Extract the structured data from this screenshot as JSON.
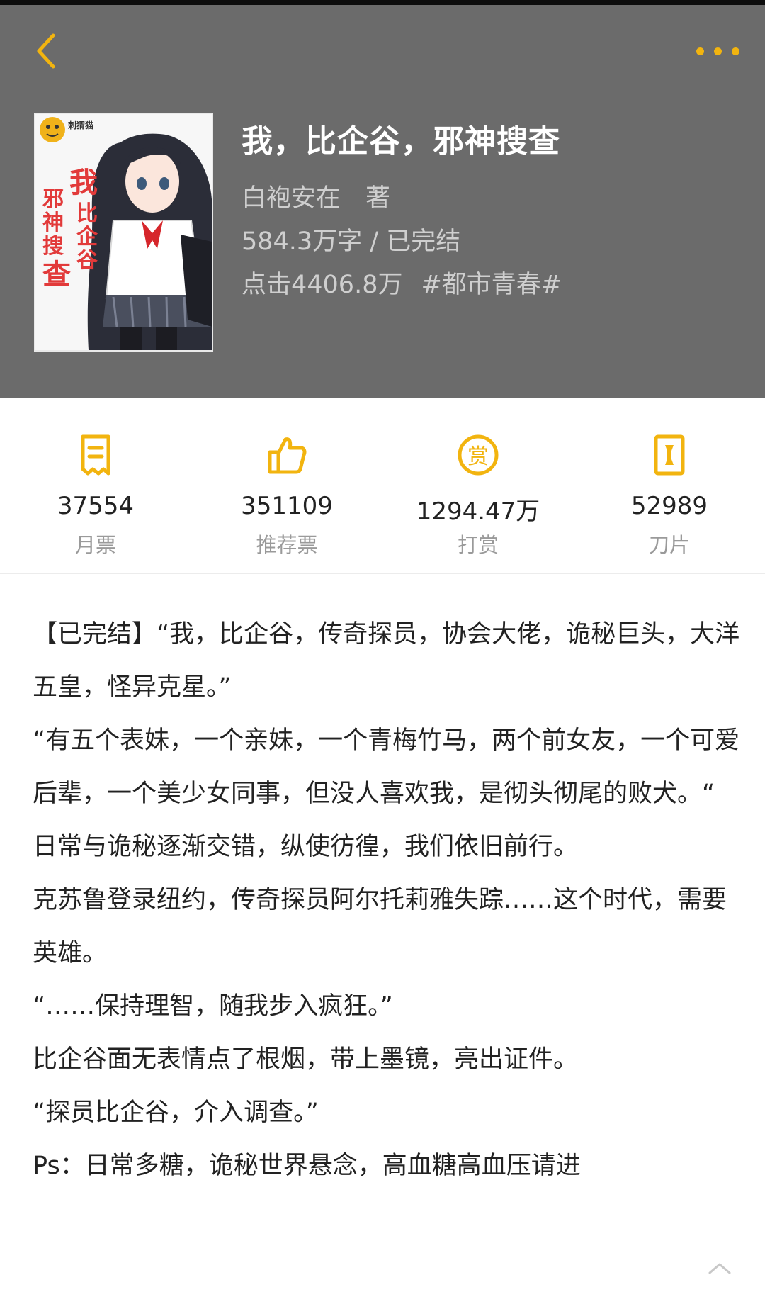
{
  "colors": {
    "accent": "#f2b40f",
    "header_bg": "#6b6b6b",
    "cover_title": "#e23a3a"
  },
  "nav": {
    "back_icon": "chevron-left-icon",
    "more_icon": "more-dots-icon"
  },
  "book": {
    "cover_publisher": "刺猬猫",
    "cover_title": "我，比企谷，邪神搜查",
    "cover_author": "白袍安在 著",
    "title": "我，比企谷，邪神搜查",
    "author_line": "白袍安在　著",
    "meta_line": "584.3万字 / 已完结",
    "clicks": "点击4406.8万",
    "tag": "#都市青春#"
  },
  "stats": [
    {
      "icon": "monthly-ticket-icon",
      "value": "37554",
      "label": "月票"
    },
    {
      "icon": "thumbs-up-icon",
      "value": "351109",
      "label": "推荐票"
    },
    {
      "icon": "reward-coin-icon",
      "value": "1294.47万",
      "label": "打赏"
    },
    {
      "icon": "blade-icon",
      "value": "52989",
      "label": "刀片"
    }
  ],
  "intro": [
    "【已完结】“我，比企谷，传奇探员，协会大佬，诡秘巨头，大洋五皇，怪异克星。”",
    "“有五个表妹，一个亲妹，一个青梅竹马，两个前女友，一个可爱后辈，一个美少女同事，但没人喜欢我，是彻头彻尾的败犬。“",
    "日常与诡秘逐渐交错，纵使彷徨，我们依旧前行。",
    "克苏鲁登录纽约，传奇探员阿尔托莉雅失踪……这个时代，需要英雄。",
    "“……保持理智，随我步入疯狂。”",
    "比企谷面无表情点了根烟，带上墨镜，亮出证件。",
    "“探员比企谷，介入调查。”",
    "Ps：日常多糖，诡秘世界悬念，高血糖高血压请进"
  ],
  "collapse_icon": "chevron-up-icon"
}
